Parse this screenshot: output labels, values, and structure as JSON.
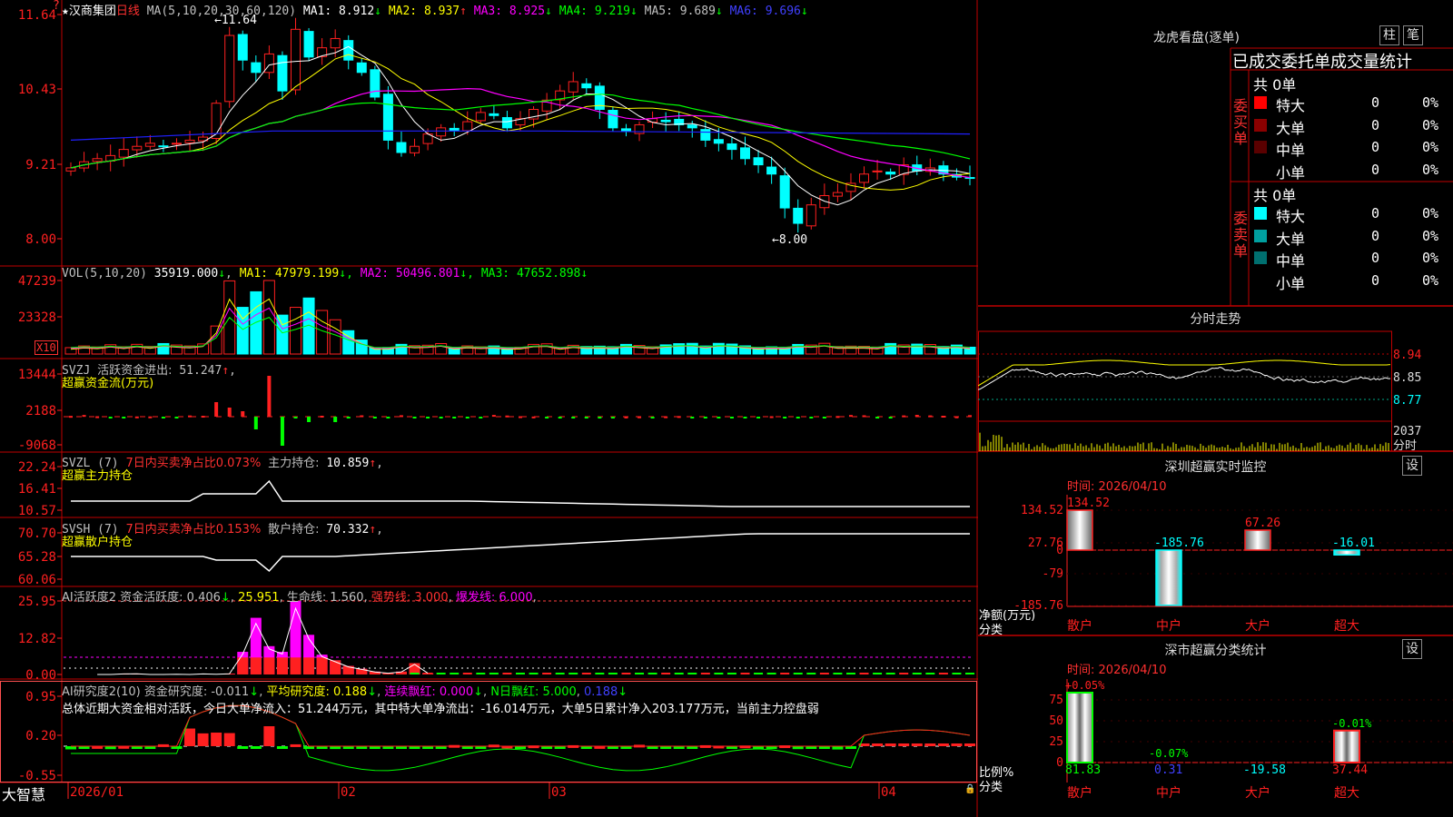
{
  "app": {
    "brand": "大智慧"
  },
  "main": {
    "header": {
      "star": "★",
      "stock_name": "汉商集团",
      "period": "日线",
      "ma_label": "MA(5,10,20,30,60,120)",
      "ma_items": [
        {
          "label": "MA1:",
          "value": "8.912",
          "arrow": "↓",
          "color": "#ffffff"
        },
        {
          "label": "MA2:",
          "value": "8.937",
          "arrow": "↑",
          "color": "#ffff00"
        },
        {
          "label": "MA3:",
          "value": "8.925",
          "arrow": "↓",
          "color": "#ff00ff"
        },
        {
          "label": "MA4:",
          "value": "9.219",
          "arrow": "↓",
          "color": "#00ff00"
        },
        {
          "label": "MA5:",
          "value": "9.689",
          "arrow": "↓",
          "color": "#c0c0c0"
        },
        {
          "label": "MA6:",
          "value": "9.696",
          "arrow": "↓",
          "color": "#4040ff"
        }
      ]
    },
    "yaxis": [
      "11.64",
      "10.43",
      "9.21",
      "8.00"
    ],
    "annotations": {
      "high": "11.64",
      "low": "8.00"
    }
  },
  "vol": {
    "title": "VOL(5,10,20)",
    "value": "35919.000",
    "ma": [
      {
        "label": "MA1:",
        "value": "47979.199",
        "color": "#ffff00"
      },
      {
        "label": "MA2:",
        "value": "50496.801",
        "color": "#ff00ff"
      },
      {
        "label": "MA3:",
        "value": "47652.898",
        "color": "#00ff00"
      }
    ],
    "yaxis": [
      "47239",
      "23328"
    ],
    "unit": "X10"
  },
  "svzj": {
    "title": "SVZJ",
    "label": "活跃资金进出:",
    "value": "51.247",
    "subtitle": "超赢资金流(万元)",
    "yaxis": [
      "13444",
      "2188",
      "-9068"
    ]
  },
  "svzl": {
    "title": "SVZL (7)",
    "desc": "7日内买卖净占比0.073%",
    "label": "主力持仓:",
    "value": "10.859",
    "subtitle": "超赢主力持仓",
    "yaxis": [
      "22.24",
      "16.41",
      "10.57"
    ]
  },
  "svsh": {
    "title": "SVSH (7)",
    "desc": "7日内买卖净占比0.153%",
    "label": "散户持仓:",
    "value": "70.332",
    "subtitle": "超赢散户持仓",
    "yaxis": [
      "70.70",
      "65.28",
      "60.06"
    ]
  },
  "ai_active": {
    "title": "AI活跃度2",
    "label1": "资金活跃度:",
    "v1": "0.406",
    "v2": "25.951",
    "label2": "生命线:",
    "v3": "1.560",
    "label3": "强势线:",
    "v4": "3.000",
    "label4": "爆发线:",
    "v5": "6.000",
    "yaxis": [
      "25.95",
      "12.82",
      "0.00"
    ]
  },
  "ai_research": {
    "title": "AI研究度2(10)",
    "label1": "资金研究度:",
    "v1": "-0.011",
    "label2": "平均研究度:",
    "v2": "0.188",
    "label3": "连续飘红:",
    "v3": "0.000",
    "label4": "N日飘红:",
    "v4": "5.000",
    "v5": "0.188",
    "summary": "总体近期大资金相对活跃，今日大单净流入：51.244万元，其中特大单净流出：-16.014万元，大单5日累计净入203.177万元，当前主力控盘弱",
    "yaxis": [
      "0.95",
      "0.20",
      "-0.55"
    ]
  },
  "xaxis": [
    "2026/01",
    "02",
    "03",
    "04"
  ],
  "dragon": {
    "title": "龙虎看盘(逐单)",
    "btn1": "柱",
    "btn2": "笔",
    "subtitle": "已成交委托单成交量统计",
    "buy": {
      "total": "共 0单",
      "side": "委买单",
      "rows": [
        {
          "name": "特大",
          "count": "0",
          "pct": "0%",
          "color": "#ff0000"
        },
        {
          "name": "大单",
          "count": "0",
          "pct": "0%",
          "color": "#8b0000"
        },
        {
          "name": "中单",
          "count": "0",
          "pct": "0%",
          "color": "#5a0000"
        },
        {
          "name": "小单",
          "count": "0",
          "pct": "0%",
          "color": ""
        }
      ]
    },
    "sell": {
      "total": "共 0单",
      "side": "委卖单",
      "rows": [
        {
          "name": "特大",
          "count": "0",
          "pct": "0%",
          "color": "#00ffff"
        },
        {
          "name": "大单",
          "count": "0",
          "pct": "0%",
          "color": "#00a0a0"
        },
        {
          "name": "中单",
          "count": "0",
          "pct": "0%",
          "color": "#007070"
        },
        {
          "name": "小单",
          "count": "0",
          "pct": "0%",
          "color": ""
        }
      ]
    }
  },
  "intraday": {
    "title": "分时走势",
    "yaxis": [
      "8.94",
      "8.85",
      "8.77"
    ],
    "vol_max": "2037",
    "vol_label": "分时"
  },
  "monitor": {
    "title": "深圳超赢实时监控",
    "btn": "设",
    "time_label": "时间:",
    "time": "2026/04/10",
    "yaxis": [
      "134.52",
      "27.76",
      "0",
      "-79",
      "-185.76"
    ],
    "ylabel": "净额(万元)",
    "xlabel": "分类",
    "categories": [
      "散户",
      "中户",
      "大户",
      "超大"
    ],
    "values": [
      134.52,
      -185.76,
      67.26,
      -16.01
    ],
    "labels": [
      "134.52",
      "-185.76",
      "67.26",
      "-16.01"
    ]
  },
  "classify": {
    "title": "深市超赢分类统计",
    "btn": "设",
    "time_label": "时间:",
    "time": "2026/04/10",
    "yaxis": [
      "75",
      "50",
      "25",
      "0"
    ],
    "ylabel": "比例%",
    "xlabel": "分类",
    "categories": [
      "散户",
      "中户",
      "大户",
      "超大"
    ],
    "top_labels": [
      "+0.05%",
      "-0.07%",
      "",
      "-0.01%"
    ],
    "bottom_labels": [
      "81.83",
      "0.31",
      "-19.58",
      "37.44"
    ],
    "values": [
      81.83,
      0.31,
      0,
      37.44
    ]
  },
  "chart_data": {
    "type": "candlestick",
    "title": "汉商集团 日线",
    "x": [
      "2026/01",
      "02",
      "03",
      "04"
    ],
    "ylim": [
      8.0,
      11.64
    ],
    "high": 11.64,
    "low": 8.0,
    "ma_last": {
      "MA1": 8.912,
      "MA2": 8.937,
      "MA3": 8.925,
      "MA4": 9.219,
      "MA5": 9.689,
      "MA6": 9.696
    }
  }
}
